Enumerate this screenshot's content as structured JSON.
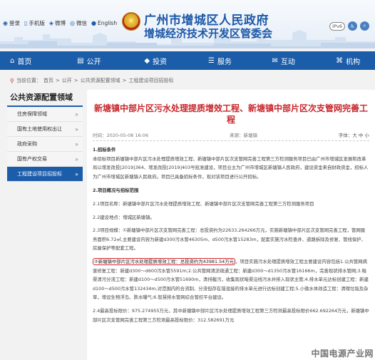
{
  "header": {
    "top_links": [
      {
        "icon": "login-icon",
        "glyph": "◉",
        "label": "登录"
      },
      {
        "icon": "mobile-icon",
        "glyph": "▯",
        "label": "手机版"
      },
      {
        "icon": "weibo-icon",
        "glyph": "◈",
        "label": "微博"
      },
      {
        "icon": "wechat-icon",
        "glyph": "◎",
        "label": "微信"
      },
      {
        "icon": "english-icon",
        "glyph": "●",
        "label": "English"
      }
    ],
    "title": "广州市增城区人民政府",
    "subtitle": "增城经济技术开发区管委会",
    "ipv6": "IPv6",
    "emblem_color": "#c8312a",
    "brand_color": "#1d58a8"
  },
  "nav": {
    "items": [
      {
        "icon": "home-icon",
        "glyph": "⌂",
        "label": "首页"
      },
      {
        "icon": "document-icon",
        "glyph": "▤",
        "label": "公开"
      },
      {
        "icon": "invest-icon",
        "glyph": "◆",
        "label": "投资"
      },
      {
        "icon": "service-icon",
        "glyph": "☰",
        "label": "服务"
      },
      {
        "icon": "interact-icon",
        "glyph": "✉",
        "label": "互动"
      },
      {
        "icon": "institution-icon",
        "glyph": "⌘",
        "label": "机构"
      }
    ],
    "color": "#1c5daa"
  },
  "breadcrumb": [
    "当前位置：",
    "首页",
    ">",
    "公开",
    ">",
    "公共资源配置领域",
    ">",
    "工程建设项目招投标"
  ],
  "sidebar": {
    "title": "公共资源配置领域",
    "items": [
      {
        "label": "住房保障领域",
        "active": false
      },
      {
        "label": "国有土地使用权出让",
        "active": false
      },
      {
        "label": "政府采购",
        "active": false
      },
      {
        "label": "国有产权交易",
        "active": false
      },
      {
        "label": "工程建设项目招投标",
        "active": true
      }
    ]
  },
  "article": {
    "title": "新塘镇中部片区污水处理提质增效工程、新塘镇中部片区次支管网完善工程",
    "date": "时间：2020-05-08 16:06",
    "source": "来源：新塘镇",
    "font_size": "字体：大 中 小",
    "h1": "1.招标条件",
    "p1": "本招标项目新塘镇中部片区污水处理提质增效工程、新塘镇中部片区次支管网完善工程第三方检测服务项目已由广州市增城区发展和改革局以增发改投[2019]364、增发改投[2019]403号批准建设，项目业主为广州市增城区新塘镇人民政府，建设资金来自财政资金，招标人为广州市增城区新塘镇人民政府。项目已具备招标条件，现对该项目进行公开招标。",
    "h2": "2.项目概况与招标范围",
    "p2": "2.1项目名称：新塘镇中部片区污水处理提质增效工程、新塘镇中部片区次支管网完善工程第三方检测服务项目",
    "p3": "2.2建设地点：增城区新塘镇。",
    "p4": "2.3项目规模：①新塘镇中部片区次支管网完善工程：总投资约为22633.264266万元，实施新塘镇中部片区次支管网完善工程，管网服务面积6.72㎡,主要建设内容为新建d300污水管46305m、d500污水管15283m，配套实施污水检查井、道路拆除及修复、管线保护、房屋保护等配套工程。",
    "p5_highlight": "②新塘镇中部片区污水处理提质增效工程：总投资约为43981.54万元",
    "p5_rest": "，项目实施污水处理提质增效工程主要建设内容包括1.公共管网病害修复工程：新建d300～d600污水管5591m;2.公共管网清淤疏通工程：新建d300～d1350污水管16166m，完善现状排水管网;3.暗渠清污分流工程：新建d100～d500污水管51690m，清排截污，收集现状暗渠沿线污水并排入现状主管;4.排水单元达标创建工程：新建d100～d500污水管132434m,对范围内的合流制、分流但存在错混接的排水单元进行达标创建工程;5.小微水体改造工程：清理垃圾及杂草，增设生物浮岛、跌水曝气;6.智慧排水管网综合管控平台建设。",
    "p6": "2.4最高投标限价：975.274955万元，其中新塘镇中部片区污水处理提质增效工程第三方检测最高投标限价662.692264万元，新塘镇中部片区次支管网完善工程第三方检测最高投标限价：312.582691万元"
  },
  "watermark": "中国电源产业网"
}
